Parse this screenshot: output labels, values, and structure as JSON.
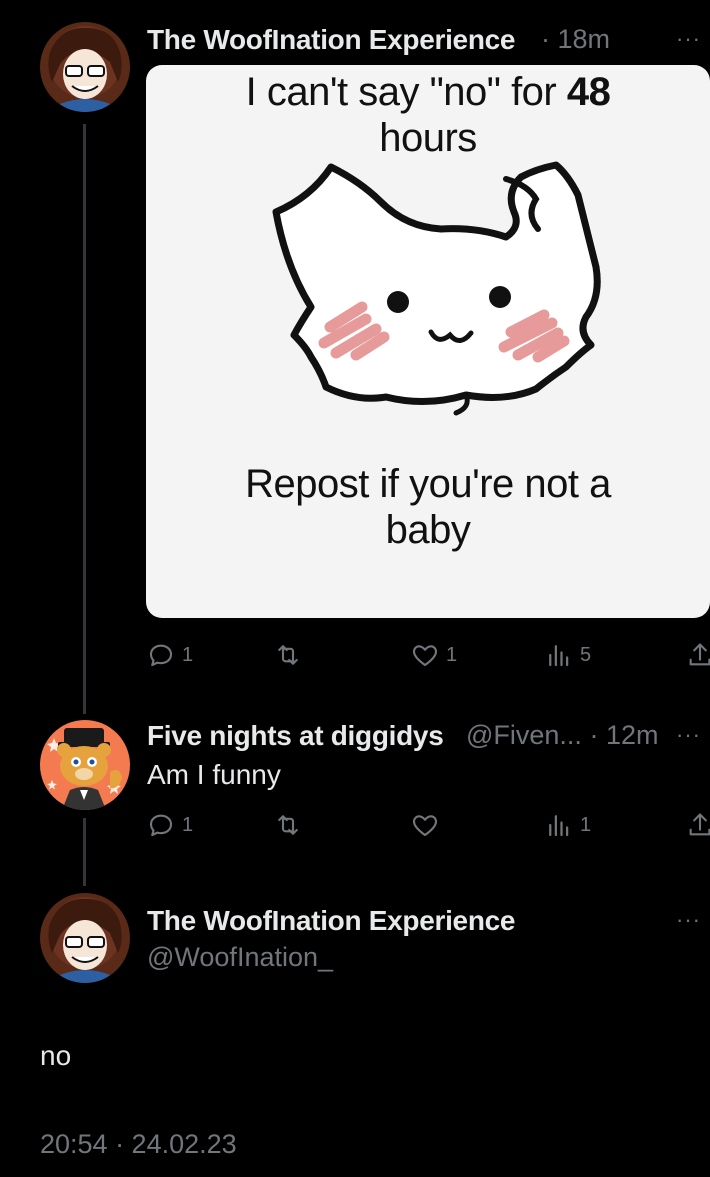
{
  "post1": {
    "author": "The WoofInation Experience",
    "separator": "·",
    "time": "18m",
    "more": "···",
    "image": {
      "top_text_a": "I can't say \"no\" for",
      "top_text_b": "48",
      "top_text_c": "hours",
      "bottom_text_a": "Repost if you're not a",
      "bottom_text_b": "baby"
    },
    "replies": "1",
    "likes": "1",
    "views": "5"
  },
  "post2": {
    "author": "Five nights at diggidys",
    "handle": "@Fiven...",
    "separator": "·",
    "time": "12m",
    "more": "···",
    "text": "Am I funny",
    "replies": "1",
    "views": "1"
  },
  "post3": {
    "author": "The WoofInation Experience",
    "handle": "@WoofInation_",
    "more": "···",
    "text": "no",
    "timestamp": "20:54 · 24.02.23"
  },
  "colors": {
    "background": "#000000",
    "text": "#e7e9ea",
    "muted": "#71767b",
    "line": "#333639"
  },
  "icons": [
    "reply-icon",
    "repost-icon",
    "like-icon",
    "views-icon",
    "share-icon",
    "more-icon"
  ]
}
